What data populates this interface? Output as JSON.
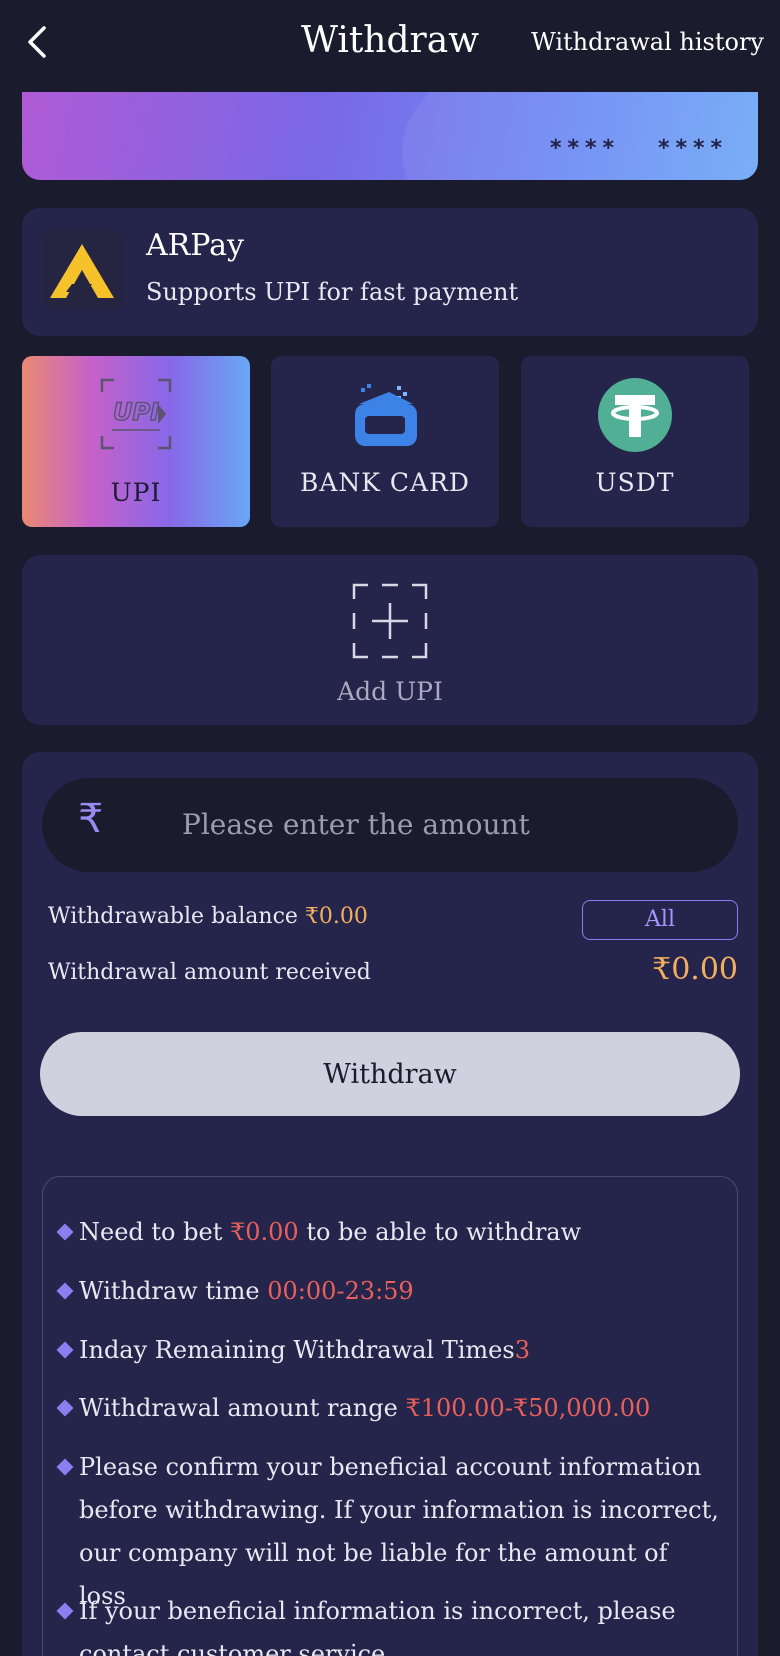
{
  "header": {
    "title": "Withdraw",
    "history_label": "Withdrawal history"
  },
  "card_banner": {
    "masked_groups": [
      "****",
      "****"
    ]
  },
  "provider": {
    "name": "ARPay",
    "description": "Supports UPI for fast payment",
    "logo_color": "#f5c22b"
  },
  "methods": [
    {
      "label": "UPI",
      "icon": "upi-icon",
      "selected": true
    },
    {
      "label": "BANK CARD",
      "icon": "bank-card-icon",
      "selected": false
    },
    {
      "label": "USDT",
      "icon": "usdt-icon",
      "selected": false
    }
  ],
  "add_upi": {
    "label": "Add UPI"
  },
  "amount": {
    "currency_symbol": "₹",
    "placeholder": "Please enter the amount"
  },
  "balance": {
    "label": "Withdrawable balance ",
    "value": "₹0.00",
    "all_label": "All",
    "received_label": "Withdrawal amount received",
    "received_value": "₹0.00"
  },
  "withdraw_button": "Withdraw",
  "rules": [
    {
      "pre": "Need to bet ",
      "hl": "₹0.00",
      "post": " to be able to withdraw"
    },
    {
      "pre": "Withdraw time ",
      "hl": "00:00-23:59",
      "post": ""
    },
    {
      "pre": "Inday Remaining Withdrawal Times",
      "hl": "3",
      "post": ""
    },
    {
      "pre": "Withdrawal amount range ",
      "hl": "₹100.00-₹50,000.00",
      "post": ""
    },
    {
      "pre": "Please confirm your beneficial account information before withdrawing. If your information is incorrect, our company will not be liable for the amount of loss",
      "hl": "",
      "post": ""
    },
    {
      "pre": "If your beneficial information is incorrect, please contact customer service",
      "hl": "",
      "post": ""
    }
  ],
  "colors": {
    "background": "#1b1b2e",
    "panel": "#25244a",
    "accent": "#8b7ef0",
    "gold": "#f2ae63",
    "highlight_red": "#e8605c",
    "usdt_green": "#50af95",
    "bank_blue": "#3d82e6"
  }
}
